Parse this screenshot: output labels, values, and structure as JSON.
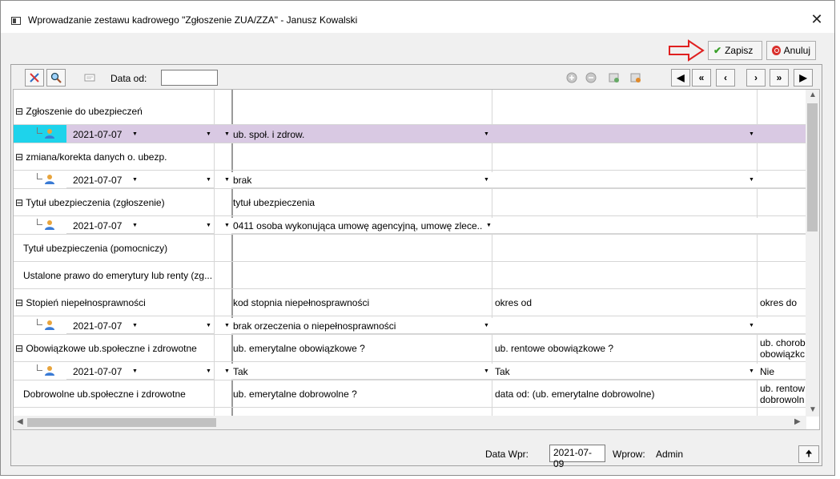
{
  "window": {
    "title": "Wprowadzanie zestawu kadrowego \"Zgłoszenie ZUA/ZZA\" - Janusz Kowalski",
    "close_glyph": "✕"
  },
  "actions": {
    "save_label": "Zapisz",
    "cancel_label": "Anuluj"
  },
  "toolbar": {
    "data_od_label": "Data od:",
    "data_od_value": "",
    "nav": [
      "◀",
      "«",
      "‹",
      "›",
      "»",
      "▶"
    ]
  },
  "rows": [
    {
      "type": "header",
      "label": "⊟ Zgłoszenie do ubezpieczeń",
      "col2": "",
      "col3": "",
      "col4": ""
    },
    {
      "type": "entry",
      "date": "2021-07-07",
      "col2": "ub. społ. i zdrow.",
      "col3": "",
      "col4": "",
      "selected": true
    },
    {
      "type": "header",
      "label": "⊟ zmiana/korekta danych o. ubezp.",
      "col2": "",
      "col3": "",
      "col4": ""
    },
    {
      "type": "entry",
      "date": "2021-07-07",
      "col2": "brak",
      "col3": "",
      "col4": ""
    },
    {
      "type": "header",
      "label": "⊟ Tytuł ubezpieczenia (zgłoszenie)",
      "col2": "tytuł ubezpieczenia",
      "col3": "",
      "col4": ""
    },
    {
      "type": "entry",
      "date": "2021-07-07",
      "col2": "0411 osoba wykonująca umowę agencyjną, umowę zlece...",
      "col3": "",
      "col4": ""
    },
    {
      "type": "header2",
      "label": "Tytuł ubezpieczenia (pomocniczy)",
      "col2": "",
      "col3": "",
      "col4": ""
    },
    {
      "type": "header2",
      "label": "Ustalone prawo do emerytury lub renty (zg...",
      "col2": "",
      "col3": "",
      "col4": ""
    },
    {
      "type": "header",
      "label": "⊟ Stopień niepełnosprawności",
      "col2": "kod stopnia niepełnosprawności",
      "col3": "okres od",
      "col4": "okres do"
    },
    {
      "type": "entry",
      "date": "2021-07-07",
      "col2": "brak orzeczenia o niepełnosprawności",
      "col3": "",
      "col4": ""
    },
    {
      "type": "header",
      "label": "⊟ Obowiązkowe ub.społeczne i zdrowotne",
      "col2": "ub. emerytalne obowiązkowe ?",
      "col3": "ub. rentowe obowiązkowe ?",
      "col4": "ub. chorob\nobowiązkc"
    },
    {
      "type": "entry",
      "date": "2021-07-07",
      "col2": "Tak",
      "col3": "Tak",
      "col4": "Nie"
    },
    {
      "type": "header2",
      "label": "Dobrowolne ub.społeczne i zdrowotne",
      "col2": "ub. emerytalne dobrowolne ?",
      "col3": "data od: (ub. emerytalne dobrowolne)",
      "col4": "ub. rentow\ndobrowoln"
    }
  ],
  "footer": {
    "data_wpr_label": "Data Wpr:",
    "data_wpr_value": "2021-07-09",
    "wprow_label": "Wprow:",
    "wprow_value": "Admin"
  },
  "colors": {
    "selected_row": "#d9c9e3",
    "selected_marker": "#1ed3eb",
    "save_check": "#3aa02a",
    "cancel_icon": "#d9302c",
    "hint_arrow": "#e02020"
  }
}
